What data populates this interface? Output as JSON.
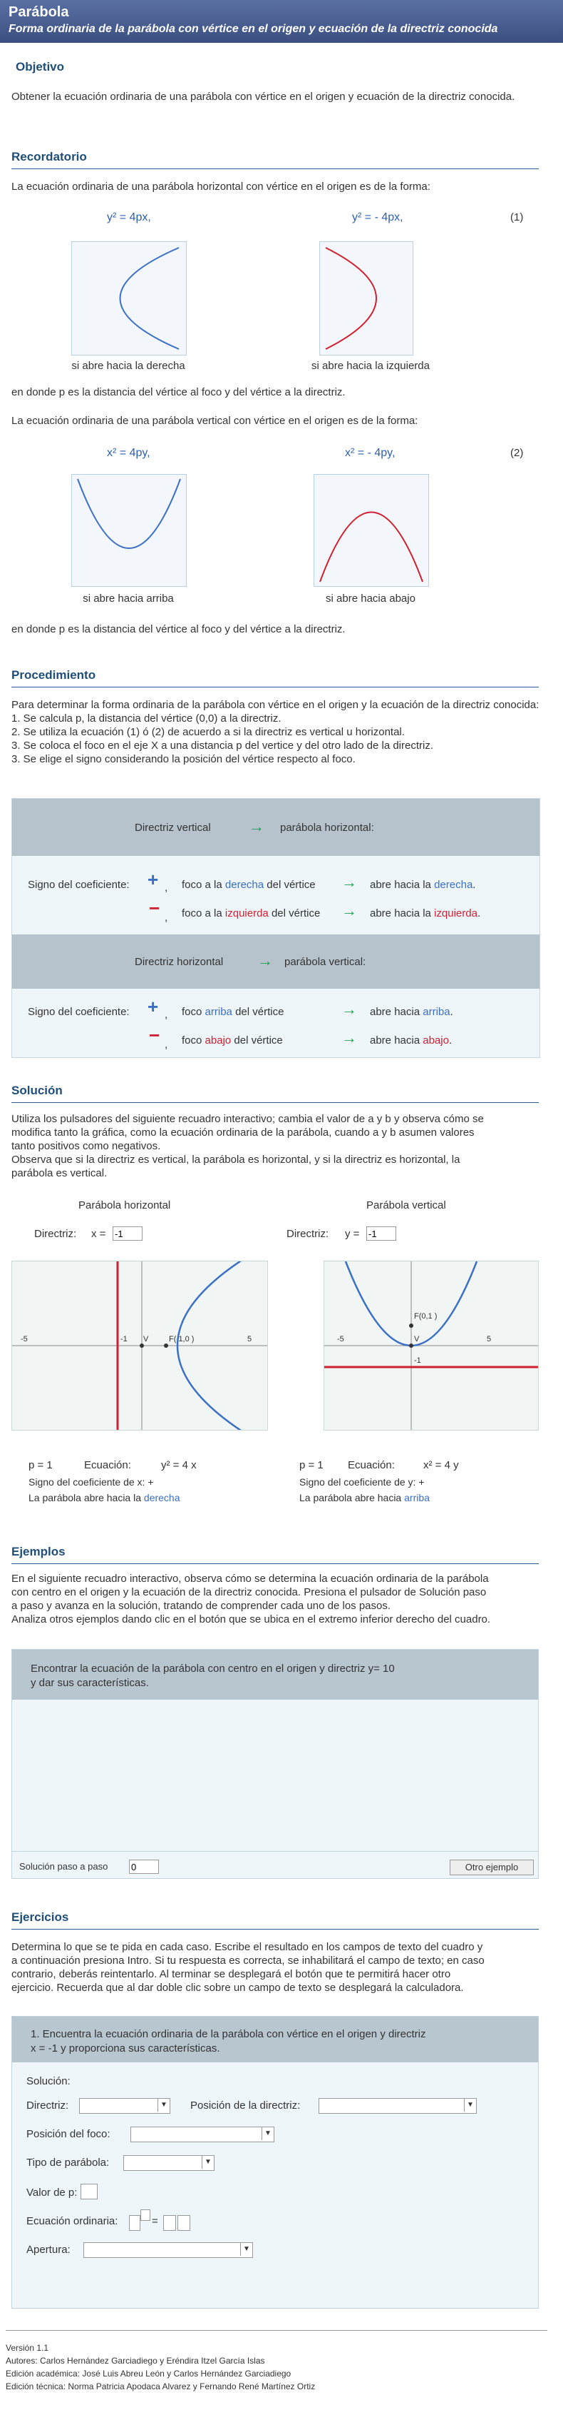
{
  "header": {
    "title": "Parábola",
    "subtitle": "Forma ordinaria de la parábola con vértice en el origen y ecuación de la directriz conocida"
  },
  "objetivo": {
    "heading": "Objetivo",
    "text": "Obtener la ecuación ordinaria de una parábola con vértice en el origen y ecuación de la directriz conocida."
  },
  "recordatorio": {
    "heading": "Recordatorio",
    "intro_h": "La ecuación ordinaria de una parábola horizontal con vértice en el origen es de la forma:",
    "eq_h1": "y² = 4px,",
    "eq_h2": "y² = - 4px,",
    "num1": "(1)",
    "cap_der": "si abre hacia la derecha",
    "cap_izq": "si abre hacia la izquierda",
    "donde1": "en donde p es la distancia del vértice al foco y del vértice a la directriz.",
    "intro_v": "La ecuación ordinaria de una parábola vertical con vértice en el origen es de la forma:",
    "eq_v1": "x² = 4py,",
    "eq_v2": "x² = - 4py,",
    "num2": "(2)",
    "cap_arr": "si abre hacia arriba",
    "cap_aba": "si abre hacia abajo",
    "donde2": "en donde p es la distancia del vértice al foco y del vértice a la directriz."
  },
  "procedimiento": {
    "heading": "Procedimiento",
    "lines": [
      "Para determinar la forma ordinaria de la parábola con vértice en el origen y la ecuación de la directriz conocida:",
      "1. Se calcula p, la distancia del vértice (0,0)  a la directriz.",
      "2. Se utiliza la ecuación (1) ó (2) de acuerdo a si la directriz es vertical u horizontal.",
      "3. Se coloca el foco en el eje X a una distancia p del vertice y del otro lado de la directriz.",
      "3. Se elige el signo considerando la posición del vértice respecto al foco."
    ],
    "table": {
      "dv": "Directriz vertical",
      "ph": "parábola horizontal:",
      "signo": "Signo del coeficiente:",
      "plus": "+",
      "minus": "−",
      "comma": ",",
      "foco_a_la": "foco a la",
      "derecha": "derecha",
      "izquierda": "izquierda",
      "del_vertice": "del vértice",
      "abre_hacia_la": "abre hacia la",
      "dh": "Directriz horizontal",
      "pv": "parábola vertical:",
      "foco": "foco",
      "arriba": "arriba",
      "abajo": "abajo",
      "abre_hacia": "abre hacia",
      "dot": "."
    }
  },
  "solucion": {
    "heading": "Solución",
    "lines": [
      "Utiliza los pulsadores del siguiente recuadro interactivo; cambia el valor de a y b y observa cómo se",
      "modifica tanto la gráfica, como la ecuación ordinaria de la parábola, cuando a y b asumen valores",
      "tanto positivos como negativos.",
      "Observa que si la directriz es vertical, la parábola es horizontal, y si la directriz es horizontal, la",
      "parábola es vertical."
    ],
    "left": {
      "title": "Parábola horizontal",
      "directriz_label": "Directriz:",
      "var": "x =",
      "value": "-1",
      "foco_label": "F( 1,0 )",
      "v": "V",
      "p": "p = 1",
      "ecuacion_label": "Ecuación:",
      "ecuacion": "y² = 4 x",
      "signo": "Signo del coeficiente de x:  +",
      "abre": "La parábola abre hacia la",
      "dir": "derecha",
      "ticks": [
        "-5",
        "-1",
        "5"
      ]
    },
    "right": {
      "title": "Parábola vertical",
      "directriz_label": "Directriz:",
      "var": "y =",
      "value": "-1",
      "foco_label": "F(0,1 )",
      "v": "V",
      "p": "p = 1",
      "ecuacion_label": "Ecuación:",
      "ecuacion": "x² = 4 y",
      "signo": "Signo del coeficiente de y:  +",
      "abre": "La parábola abre hacia",
      "dir": "arriba",
      "ticks": [
        "-5",
        "5",
        "-1"
      ]
    }
  },
  "ejemplos": {
    "heading": "Ejemplos",
    "lines": [
      "En el siguiente recuadro interactivo, observa cómo se determina la ecuación ordinaria de la parábola",
      "con centro en el origen y la ecuación de la directriz conocida. Presiona el pulsador de  Solución paso",
      "a paso y avanza en la solución, tratando de comprender cada uno de los pasos.",
      "Analiza otros ejemplos dando clic en el botón que se ubica en el extremo inferior derecho del cuadro."
    ],
    "box_line1": "Encontrar la ecuación de la parábola con centro en el origen y directriz y= 10",
    "box_line2": "y dar sus características.",
    "paso_label": "Solución paso a paso",
    "paso_value": "0",
    "otro": "Otro ejemplo"
  },
  "ejercicios": {
    "heading": "Ejercicios",
    "lines": [
      "Determina lo que se te pida en cada caso. Escribe el resultado en los campos de texto del cuadro y",
      "a continuación presiona Intro. Si tu respuesta es correcta, se inhabilitará el campo de texto; en caso",
      "contrario, deberás reintentarlo. Al terminar se desplegará el botón que te permitirá hacer otro",
      "ejercicio. Recuerda que al dar doble clic sobre un campo de texto se desplegará la calculadora."
    ],
    "box_line1": "1.  Encuentra la ecuación ordinaria de la parábola con vértice en el origen y directriz",
    "box_line2": "x = -1  y proporciona sus características.",
    "solucion": "Solución:",
    "directriz": "Directriz:",
    "posicion_directriz": "Posición de la directriz:",
    "posicion_foco": "Posición del foco:",
    "tipo": "Tipo de parábola:",
    "valor_p": "Valor de p:",
    "ecuacion": "Ecuación ordinaria:",
    "eq_sign": "=",
    "apertura": "Apertura:"
  },
  "footer": {
    "version": "Versión 1.1",
    "autores": "Autores: Carlos Hernández Garciadiego y Eréndira Itzel García Islas",
    "academica": "Edición académica: José Luis Abreu León y  Carlos Hernández Garciadiego",
    "tecnica": "Edición técnica: Norma Patricia Apodaca Alvarez y Fernando René Martínez Ortiz"
  },
  "colors": {
    "banner": "#4a5f93",
    "heading": "#1f4e79",
    "blue": "#3a6fc4",
    "red": "#d02030",
    "purple": "#8e44ad",
    "green": "#1aa34a"
  }
}
